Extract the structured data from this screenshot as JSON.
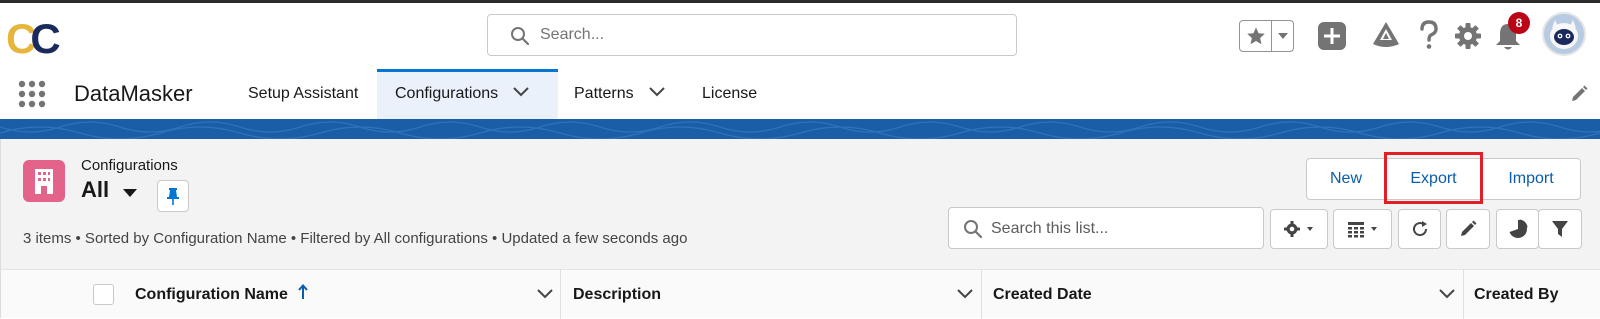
{
  "header": {
    "logo_text_1": "C",
    "logo_text_2": "C",
    "search_placeholder": "Search...",
    "notification_count": "8",
    "icons": [
      "search-icon",
      "star-icon",
      "chevron-down-icon",
      "add-icon",
      "trailhead-icon",
      "help-icon",
      "gear-icon",
      "bell-icon",
      "avatar"
    ]
  },
  "nav": {
    "app_name": "DataMasker",
    "tabs": [
      {
        "label": "Setup Assistant",
        "active": false
      },
      {
        "label": "Configurations",
        "active": true
      },
      {
        "label": "Patterns",
        "active": false
      },
      {
        "label": "License",
        "active": false
      }
    ]
  },
  "list_view": {
    "object_label": "Configurations",
    "view_name": "All",
    "buttons": {
      "new": "New",
      "export": "Export",
      "import": "Import"
    },
    "highlighted_button": "Export",
    "search_placeholder": "Search this list...",
    "status": "3 items • Sorted by Configuration Name • Filtered by All configurations • Updated a few seconds ago",
    "columns": [
      {
        "label": "Configuration Name",
        "sort": "ascending"
      },
      {
        "label": "Description"
      },
      {
        "label": "Created Date"
      },
      {
        "label": "Created By"
      }
    ]
  },
  "colors": {
    "brand_blue": "#0176d3",
    "link_blue": "#0b5cab",
    "band_blue": "#1b5ea8",
    "object_icon_pink": "#e3638a",
    "highlight_red": "#e01f26",
    "badge_red": "#ba0517",
    "logo_gold": "#e8b53c",
    "logo_navy": "#1b2a5c"
  }
}
